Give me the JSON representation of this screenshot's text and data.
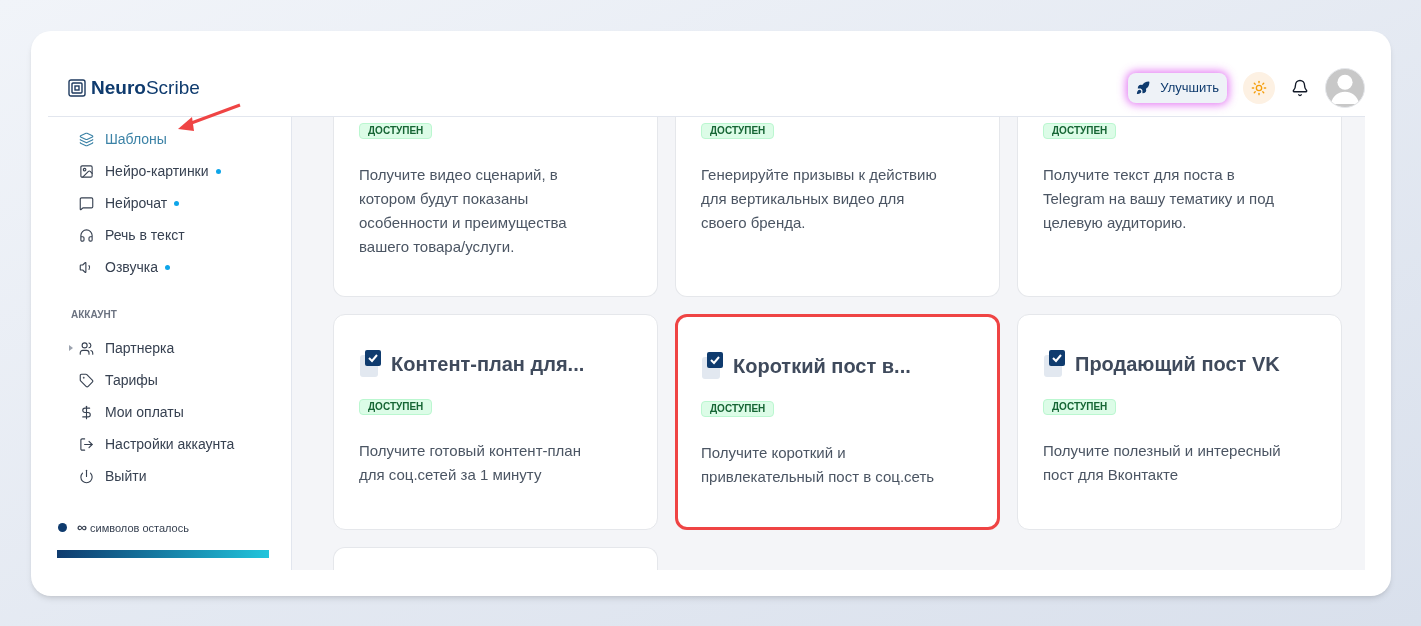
{
  "logo": {
    "bold": "Neuro",
    "light": "Scribe"
  },
  "header": {
    "upgrade_button": "Улучшить"
  },
  "sidebar": {
    "items": [
      {
        "label": "Шаблоны",
        "selected": true,
        "dot": false
      },
      {
        "label": "Нейро-картинки",
        "selected": false,
        "dot": true
      },
      {
        "label": "Нейрочат",
        "selected": false,
        "dot": true
      },
      {
        "label": "Речь в текст",
        "selected": false,
        "dot": false
      },
      {
        "label": "Озвучка",
        "selected": false,
        "dot": true
      }
    ],
    "section_title": "АККАУНТ",
    "account_items": [
      {
        "label": "Партнерка",
        "expanded": false
      },
      {
        "label": "Тарифы"
      },
      {
        "label": "Мои оплаты"
      },
      {
        "label": "Настройки аккаунта"
      },
      {
        "label": "Выйти"
      }
    ],
    "quota": {
      "amount": "∞",
      "label": "символов осталось",
      "level": 1
    }
  },
  "cards": [
    {
      "badge": "ДОСТУПЕН",
      "description": "Получите видео сценарий, в котором будут показаны особенности и преимущества вашего товара/услуги.",
      "highlighted": false
    },
    {
      "badge": "ДОСТУПЕН",
      "description": "Генерируйте призывы к действию для вертикальных видео для своего бренда.",
      "highlighted": false
    },
    {
      "badge": "ДОСТУПЕН",
      "description": "Получите текст для поста в Telegram на вашу тематику и под целевую аудиторию.",
      "highlighted": false
    },
    {
      "title": "Контент-план для...",
      "badge": "ДОСТУПЕН",
      "description": "Получите готовый контент-план для соц.сетей за 1 минуту",
      "highlighted": false
    },
    {
      "title": "Короткий пост в...",
      "badge": "ДОСТУПЕН",
      "description": "Получите короткий и привлекательный пост в соц.сеть",
      "highlighted": true
    },
    {
      "title": "Продающий пост VK",
      "badge": "ДОСТУПЕН",
      "description": "Получите полезный и интересный пост для Вконтакте",
      "highlighted": false
    },
    {
      "highlighted": false
    }
  ]
}
